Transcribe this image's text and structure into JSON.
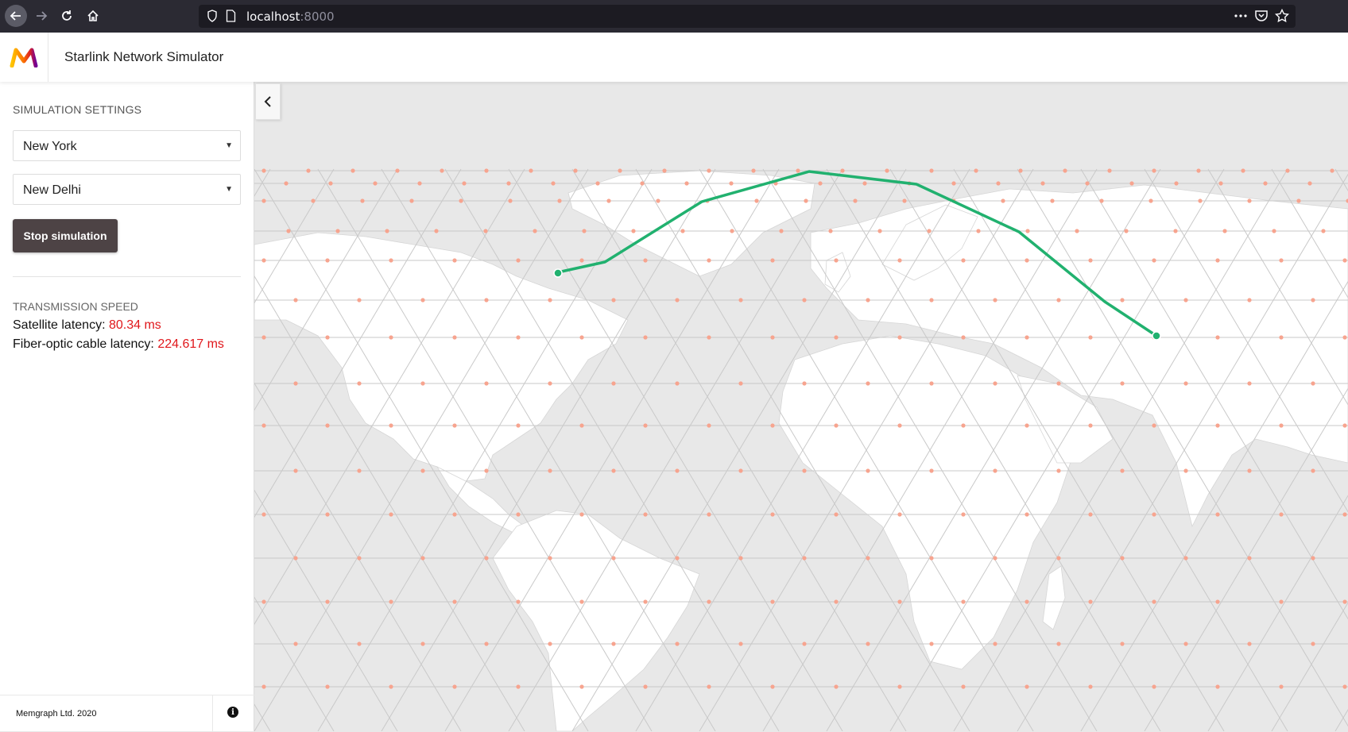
{
  "browser": {
    "url_host": "localhost",
    "url_port": ":8000"
  },
  "header": {
    "title": "Starlink Network Simulator"
  },
  "sidebar": {
    "settings_heading": "SIMULATION SETTINGS",
    "from_city": "New York",
    "to_city": "New Delhi",
    "stop_button_label": "Stop simulation",
    "transmission_heading": "TRANSMISSION SPEED",
    "satellite_latency_label": "Satellite latency:",
    "satellite_latency_value": "80.34 ms",
    "fiber_latency_label": "Fiber-optic cable latency:",
    "fiber_latency_value": "224.617 ms",
    "footer_text": "Memgraph Ltd. 2020"
  },
  "colors": {
    "route": "#21b16f",
    "satellite": "#f7a48f",
    "latency_value": "#e0171b",
    "button_bg": "#4d4345"
  },
  "icons": [
    "back-arrow-icon",
    "forward-arrow-icon",
    "reload-icon",
    "home-icon",
    "shield-icon",
    "page-icon",
    "more-icon",
    "pocket-icon",
    "star-icon",
    "memgraph-logo",
    "chevron-left-icon",
    "info-icon",
    "dropdown-caret-icon"
  ]
}
